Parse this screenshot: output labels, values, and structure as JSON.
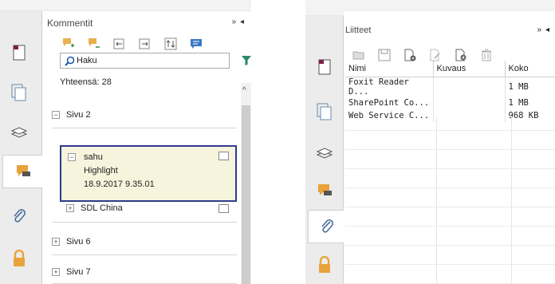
{
  "comments_panel": {
    "title": "Kommentit",
    "controls": "» ◂",
    "search_placeholder": "Haku",
    "total_label": "Yhteensä: 28",
    "groups": {
      "sivu2": "Sivu 2",
      "sivu6": "Sivu 6",
      "sivu7": "Sivu 7"
    },
    "selected_comment": {
      "author": "sahu",
      "type": "Highlight",
      "timestamp": "18.9.2017 9.35.01"
    },
    "sub_item": "SDL China",
    "expander_collapsed": "+",
    "expander_expanded": "−"
  },
  "attachments_panel": {
    "title": "Liitteet",
    "controls": "» ◂",
    "columns": [
      "Nimi",
      "Kuvaus",
      "Koko"
    ],
    "rows": [
      {
        "name": "Foxit Reader D...",
        "desc": "",
        "size": "1 MB"
      },
      {
        "name": "SharePoint Co...",
        "desc": "",
        "size": "1 MB"
      },
      {
        "name": "Web Service C...",
        "desc": "",
        "size": "968 KB"
      }
    ]
  },
  "colors": {
    "accent_blue": "#2f3b8c",
    "highlight_bg": "#f6f4dc",
    "icon_orange": "#e8a33a"
  }
}
